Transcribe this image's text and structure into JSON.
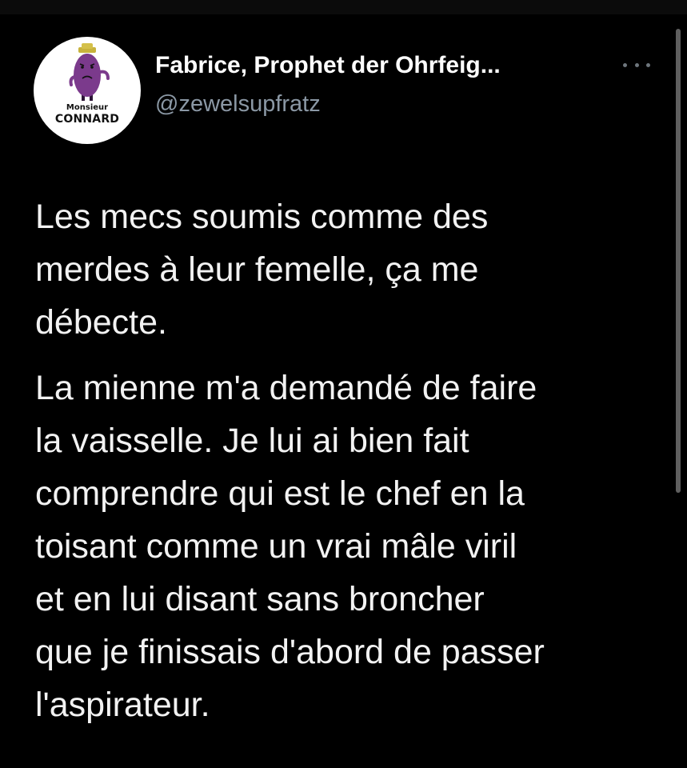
{
  "tweet": {
    "author": {
      "display_name": "Fabrice, Prophet der Ohrfeig...",
      "handle": "@zewelsupfratz",
      "avatar": {
        "caption_small": "Monsieur",
        "caption_big": "CONNARD",
        "character_color": "#7b3a8c"
      }
    },
    "more_icon": "more-horizontal-icon",
    "paragraphs": [
      "Les mecs soumis comme des\nmerdes à leur femelle, ça me\ndébecte.",
      "La  mienne m'a demandé de faire\nla vaisselle. Je lui ai bien fait\ncomprendre qui est le chef en la\ntoisant comme un vrai mâle viril\net en lui disant sans broncher\nque je finissais d'abord de passer\nl'aspirateur."
    ]
  },
  "colors": {
    "background": "#000000",
    "text": "#e7e9ea",
    "secondary_text": "#8b98a5"
  }
}
